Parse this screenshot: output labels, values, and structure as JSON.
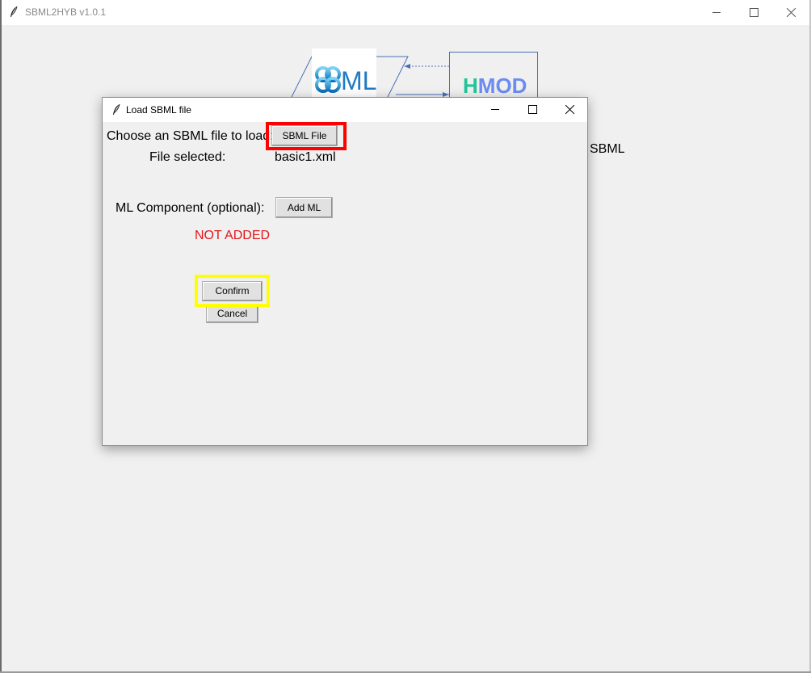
{
  "main_window": {
    "title": "SBML2HYB v1.0.1",
    "hmod_logo": {
      "h": "H",
      "rest": "MOD"
    },
    "sbml_logo": "SBML",
    "background_label": "SBML"
  },
  "dialog": {
    "title": "Load SBML file",
    "choose_label": "Choose an SBML file to load:",
    "sbml_file_button": "SBML File",
    "file_selected_label": "File selected:",
    "file_selected_value": "basic1.xml",
    "ml_component_label": "ML Component (optional):",
    "add_ml_button": "Add ML",
    "ml_status": "NOT ADDED",
    "confirm_button": "Confirm",
    "cancel_button": "Cancel"
  },
  "colors": {
    "status_red": "#e0161b",
    "highlight_red": "#ff0000",
    "highlight_yellow": "#ffff00",
    "hmod_h": "#22c59a",
    "hmod_mod": "#6d8cf0"
  },
  "icons": [
    "feather-icon",
    "minimize-icon",
    "maximize-icon",
    "close-icon"
  ]
}
